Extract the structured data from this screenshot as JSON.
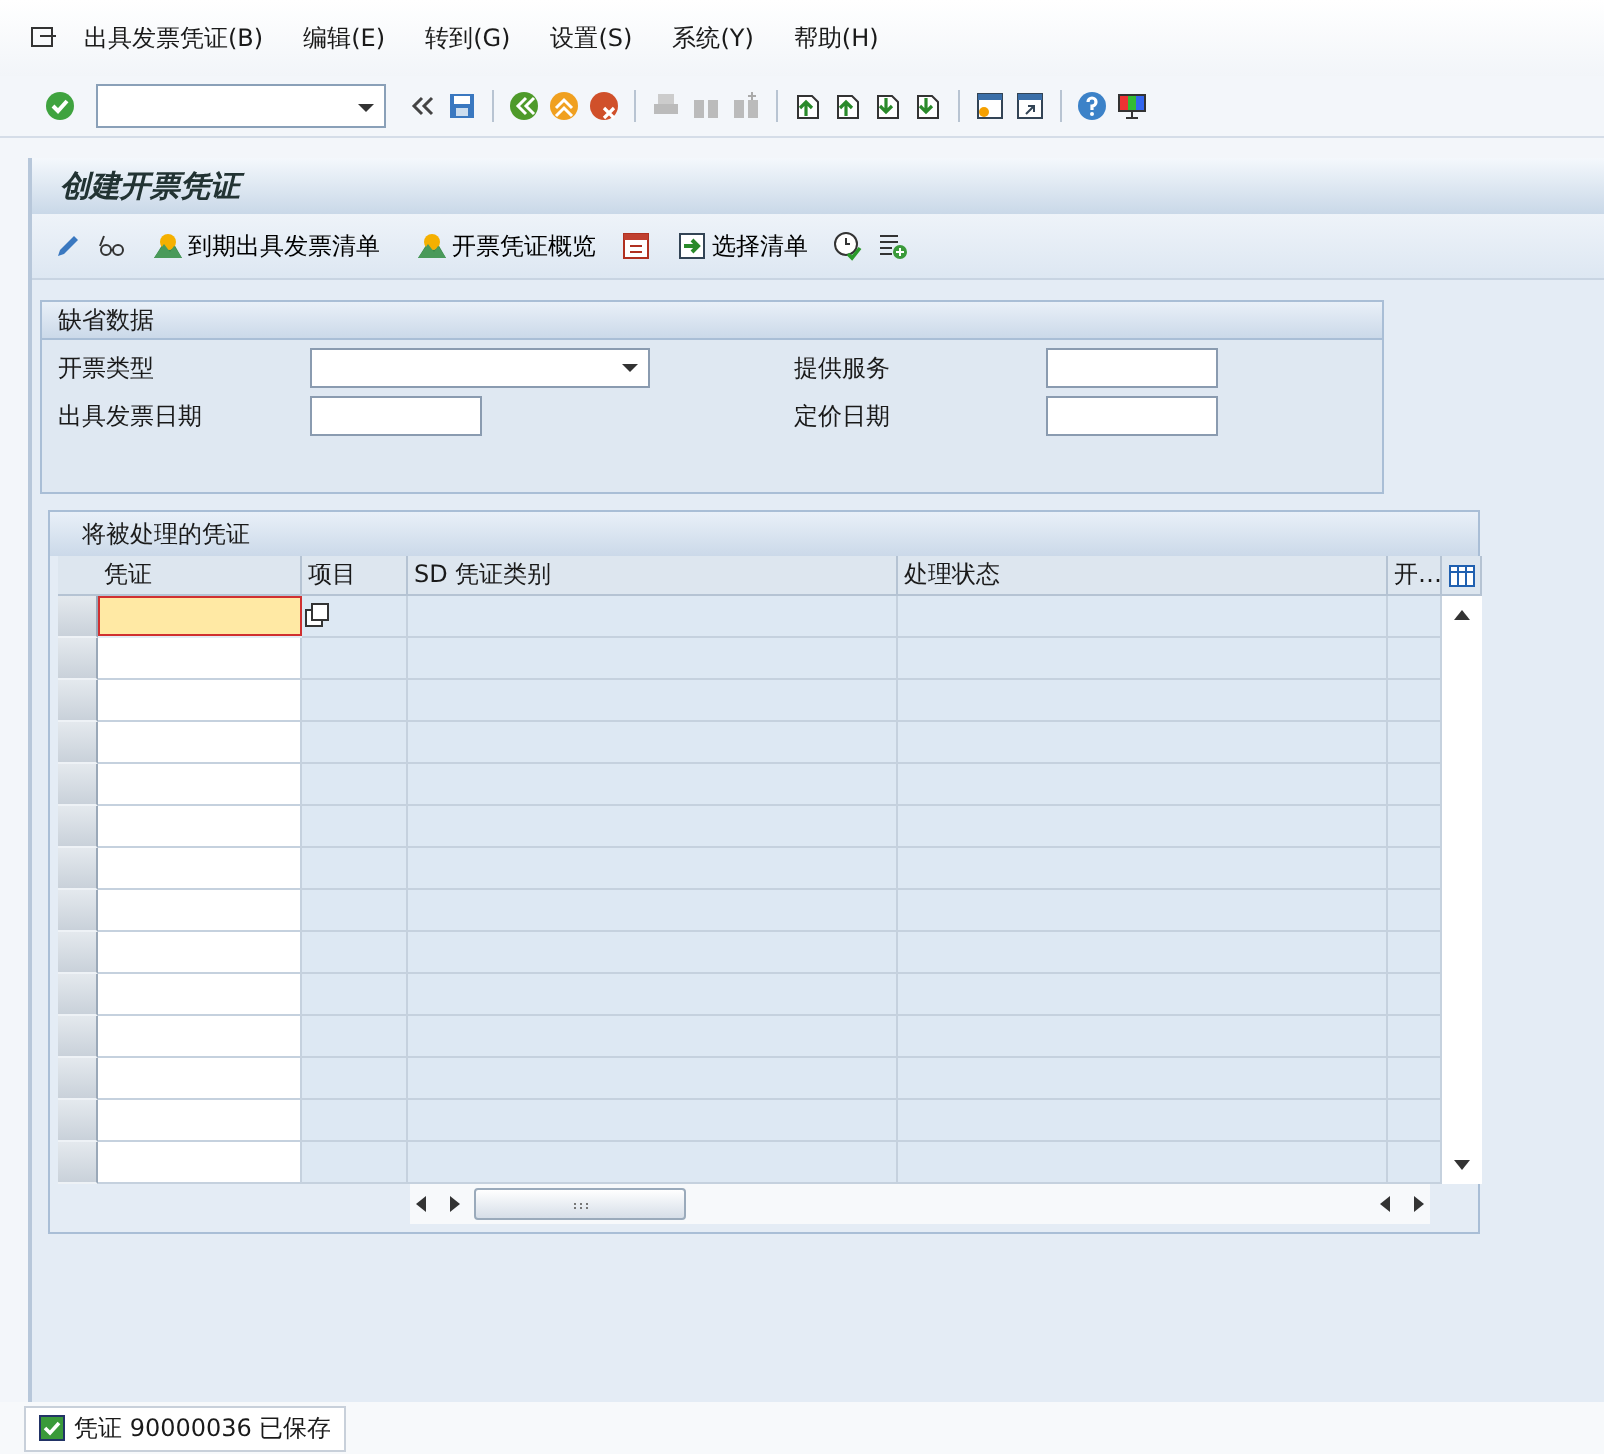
{
  "menu_bar": {
    "items": [
      "出具发票凭证(B)",
      "编辑(E)",
      "转到(G)",
      "设置(S)",
      "系统(Y)",
      "帮助(H)"
    ]
  },
  "title": "创建开票凭证",
  "app_toolbar": {
    "buttons": [
      "到期出具发票清单",
      "开票凭证概览",
      "选择清单"
    ]
  },
  "defaults_group": {
    "title": "缺省数据",
    "fields": [
      {
        "label": "开票类型",
        "kind": "dropdown"
      },
      {
        "label": "提供服务",
        "kind": "text"
      },
      {
        "label": "出具发票日期",
        "kind": "text"
      },
      {
        "label": "定价日期",
        "kind": "text"
      }
    ]
  },
  "documents_table": {
    "title": "将被处理的凭证",
    "columns": [
      "凭证",
      "项目",
      "SD 凭证类别",
      "处理状态",
      "开…"
    ]
  },
  "status_bar": {
    "kind": "success",
    "message": "凭证 90000036 已保存"
  }
}
